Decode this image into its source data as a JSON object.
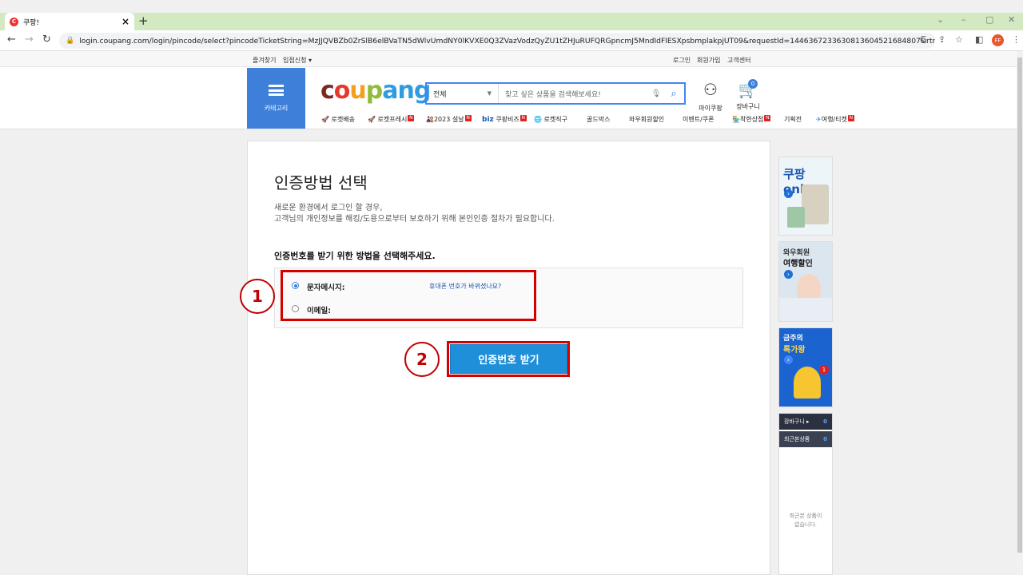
{
  "browser": {
    "tab_title": "쿠팡!",
    "url": "login.coupang.com/login/pincode/select?pincodeTicketString=MzJJQVBZb0ZrSlB6elBVaTN5dWlvUmdNY0lKVXE0Q3ZVazVodzQyZU1tZHJuRUFQRGpncmJ5MndIdFlESXpsbmplakpjUT09&requestId=1446367233630813604521684807&rtnUrl=https%...",
    "profile_initials": "FF"
  },
  "topbar": {
    "bookmark": "즐겨찾기",
    "vendor": "입점신청",
    "login": "로그인",
    "signup": "회원가입",
    "support": "고객센터"
  },
  "header": {
    "category_label": "카테고리",
    "search_category": "전체",
    "search_placeholder": "찾고 싶은 상품을 검색해보세요!",
    "mycoupang": "마이쿠팡",
    "cart": "장바구니",
    "cart_count": "0",
    "nav": [
      "로켓배송",
      "로켓프레시",
      "2023 설날",
      "쿠팡비즈",
      "로켓직구",
      "골드박스",
      "와우회원할인",
      "이벤트/쿠폰",
      "착한상점",
      "기획전",
      "여행/티켓"
    ],
    "nav_biz_prefix": "biz"
  },
  "main": {
    "title": "인증방법 선택",
    "desc_line1": "새로운 환경에서 로그인 할 경우,",
    "desc_line2": "고객님의 개인정보를 해킹/도용으로부터 보호하기 위해 본인인증 절차가 필요합니다.",
    "subheading": "인증번호를 받기 위한 방법을 선택해주세요.",
    "option_sms": "문자메시지:",
    "option_email": "이메일:",
    "phone_changed_link": "휴대폰 번호가 바뀌셨나요?",
    "submit": "인증번호 받기",
    "step1": "1",
    "step2": "2"
  },
  "sidebar": {
    "banner1": "쿠팡 only",
    "banner2_line1": "와우회원",
    "banner2_line2": "여행할인",
    "banner3_line1": "금주의",
    "banner3_line2": "특가왕",
    "banner3_badge": "1",
    "cart_label": "장바구니",
    "cart_count": "0",
    "recent_label": "최근본상품",
    "recent_count": "0",
    "empty_line1": "최근본 상품이",
    "empty_line2": "없습니다."
  },
  "colors": {
    "accent": "#3d7fd9",
    "button": "#1e8fd8",
    "highlight": "#d40000"
  }
}
